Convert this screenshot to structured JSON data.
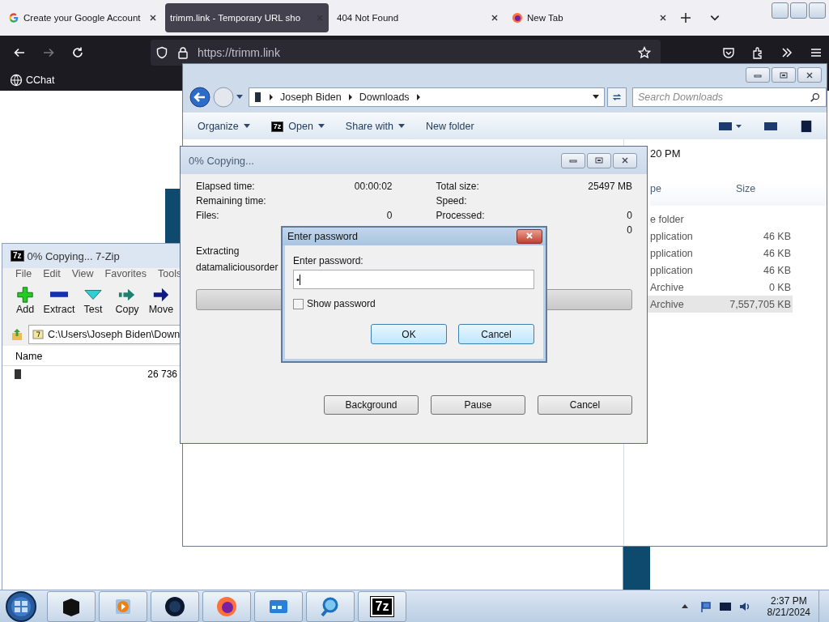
{
  "browser": {
    "tabs": [
      {
        "title": "Create your Google Account",
        "kind": "google",
        "selected": false
      },
      {
        "title": "trimm.link - Temporary URL sho",
        "kind": "plain",
        "selected": true
      },
      {
        "title": "404 Not Found",
        "kind": "plain",
        "selected": false
      },
      {
        "title": "New Tab",
        "kind": "firefox",
        "selected": false
      }
    ],
    "url": "https://trimm.link",
    "bookmarks": [
      {
        "label": "CChat"
      }
    ]
  },
  "explorer": {
    "breadcrumb": [
      "Joseph Biden",
      "Downloads"
    ],
    "search": {
      "placeholder": "Search Downloads"
    },
    "toolbar": [
      {
        "label": "Organize",
        "menu": true
      },
      {
        "label": "Open",
        "menu": true,
        "icon_label": "7z"
      },
      {
        "label": "Share with",
        "menu": true
      },
      {
        "label": "New folder",
        "menu": false
      }
    ],
    "date_fragment": "20 PM",
    "columns": [
      "pe",
      "Size"
    ],
    "rows": [
      {
        "type": "e folder",
        "selected": false
      },
      {
        "type": "pplication",
        "size": "46 KB",
        "selected": false
      },
      {
        "type": "pplication",
        "size": "46 KB",
        "selected": false
      },
      {
        "type": "pplication",
        "size": "46 KB",
        "selected": false
      },
      {
        "type": "Archive",
        "size": "0 KB",
        "selected": false
      },
      {
        "type": "Archive",
        "size": "7,557,705 KB",
        "selected": true
      }
    ]
  },
  "sevenzip": {
    "icon_label": "7z",
    "title": "0% Copying... 7-Zip",
    "menu": [
      "File",
      "Edit",
      "View",
      "Favorites",
      "Tools"
    ],
    "tools": [
      {
        "label": "Add",
        "kind": "add"
      },
      {
        "label": "Extract",
        "kind": "extract"
      },
      {
        "label": "Test",
        "kind": "test"
      },
      {
        "label": "Copy",
        "kind": "copy"
      },
      {
        "label": "Move",
        "kind": "move"
      }
    ],
    "path": "C:\\Users\\Joseph Biden\\Down",
    "columns": [
      "Name"
    ],
    "rows": [
      {
        "size": "26 736"
      }
    ]
  },
  "copy_dialog": {
    "title": "0% Copying...",
    "stats_left": [
      {
        "label": "Elapsed time:",
        "value": "00:00:02"
      },
      {
        "label": "Remaining time:"
      },
      {
        "label": "Files:",
        "value": "0"
      }
    ],
    "stats_right": [
      {
        "label": "Total size:",
        "value": "25497 MB"
      },
      {
        "label": "Speed:"
      },
      {
        "label": "Processed:",
        "value": "0"
      },
      {
        "value": "0"
      }
    ],
    "operation": "Extracting",
    "file": "datamaliciousorder",
    "progress": {
      "level": 0
    },
    "buttons": [
      "Background",
      "Pause",
      "Cancel"
    ]
  },
  "password_dialog": {
    "title": "Enter password",
    "label": "Enter password:",
    "value": "•",
    "show_password": {
      "label": "Show password",
      "checked": false
    },
    "buttons": [
      "OK",
      "Cancel"
    ]
  },
  "taskbar": {
    "apps": [
      {
        "kind": "box"
      },
      {
        "kind": "media"
      },
      {
        "kind": "globe"
      },
      {
        "kind": "firefox"
      },
      {
        "kind": "window"
      },
      {
        "kind": "magnifier"
      },
      {
        "kind": "archiver",
        "label": "7z"
      }
    ],
    "clock": {
      "time": "2:37 PM",
      "date": "8/21/2024"
    }
  }
}
